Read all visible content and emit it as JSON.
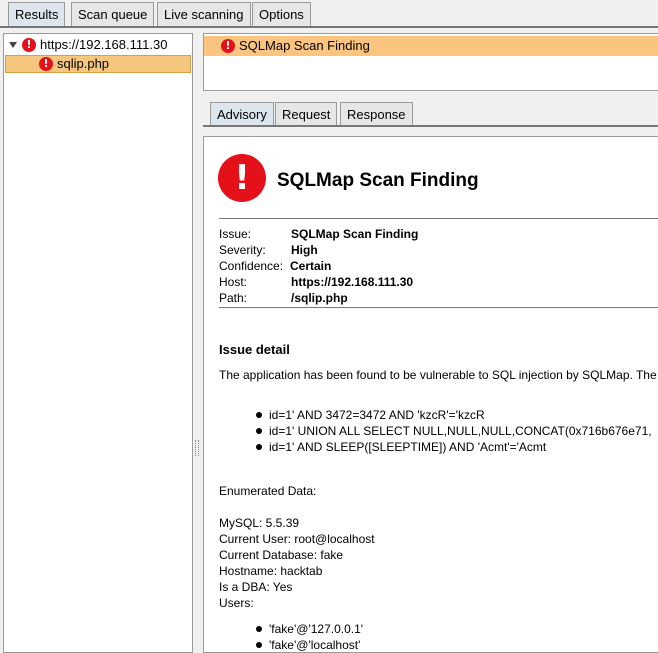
{
  "main_tabs": [
    "Results",
    "Scan queue",
    "Live scanning",
    "Options"
  ],
  "tree": {
    "host": "https://192.168.111.30",
    "child": "sqlip.php"
  },
  "issue_list": {
    "selected": "SQLMap Scan Finding"
  },
  "detail_tabs": [
    "Advisory",
    "Request",
    "Response"
  ],
  "advisory": {
    "title": "SQLMap Scan Finding",
    "props": [
      {
        "key": "Issue:",
        "value": "SQLMap Scan Finding"
      },
      {
        "key": "Severity:",
        "value": "High"
      },
      {
        "key": "Confidence:",
        "value": "Certain"
      },
      {
        "key": "Host:",
        "value": "https://192.168.111.30"
      },
      {
        "key": "Path:",
        "value": "/sqlip.php"
      }
    ],
    "issue_detail_heading": "Issue detail",
    "issue_detail_text": "The application has been found to be vulnerable to SQL injection by SQLMap. The",
    "payloads": [
      "id=1' AND 3472=3472 AND 'kzcR'='kzcR",
      "id=1' UNION ALL SELECT NULL,NULL,NULL,CONCAT(0x716b676e71,",
      "id=1' AND SLEEP([SLEEPTIME]) AND 'Acmt'='Acmt"
    ],
    "enumerated_heading": "Enumerated Data:",
    "enumerated": [
      "MySQL: 5.5.39",
      "Current User: root@localhost",
      "Current Database: fake",
      "Hostname: hacktab",
      "Is a DBA: Yes",
      "Users:"
    ],
    "users": [
      "'fake'@'127.0.0.1'",
      "'fake'@'localhost'"
    ]
  },
  "colors": {
    "alert_red": "#e4101a",
    "selection_orange": "#fbc57f",
    "tree_selection": "#f5c77e"
  },
  "icons": {
    "alert": "exclamation-circle",
    "expander": "triangle-down",
    "bullet": "filled-circle"
  }
}
